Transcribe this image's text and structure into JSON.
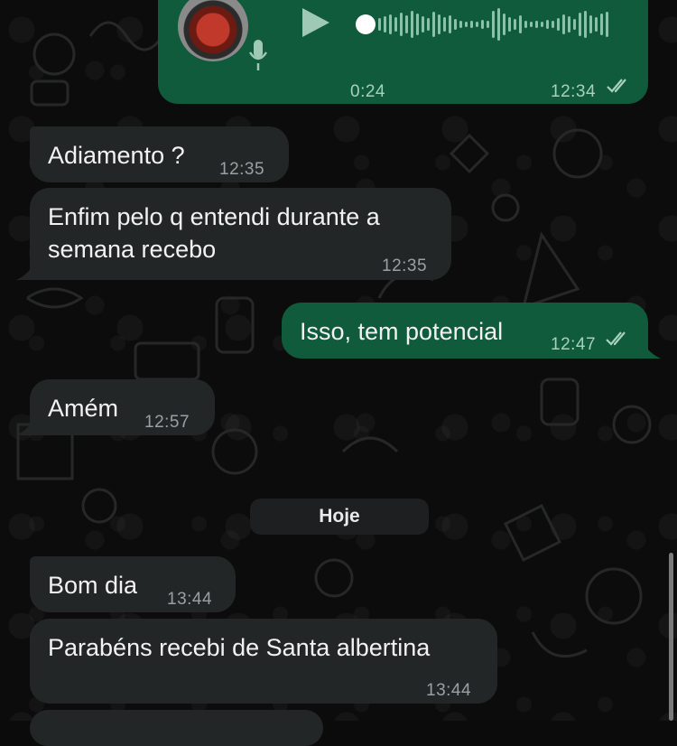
{
  "audio_message": {
    "duration": "0:24",
    "time": "12:34",
    "status_icon": "double-check-icon",
    "progress": 0
  },
  "messages": [
    {
      "direction": "in",
      "text": "Adiamento ?",
      "time": "12:35"
    },
    {
      "direction": "in",
      "text": "Enfim pelo q entendi durante a semana recebo",
      "time": "12:35"
    },
    {
      "direction": "out",
      "text": "Isso, tem potencial",
      "time": "12:47",
      "status_icon": "double-check-icon"
    },
    {
      "direction": "in",
      "text": "Amém",
      "time": "12:57"
    },
    {
      "direction": "in",
      "text": "Bom dia",
      "time": "13:44"
    },
    {
      "direction": "in",
      "text": "Parabéns recebi de Santa albertina",
      "time": "13:44"
    }
  ],
  "date_divider": "Hoje",
  "colors": {
    "incoming_bubble": "#232627",
    "outgoing_bubble": "#0f5b3c",
    "background": "#0b0b0b"
  }
}
